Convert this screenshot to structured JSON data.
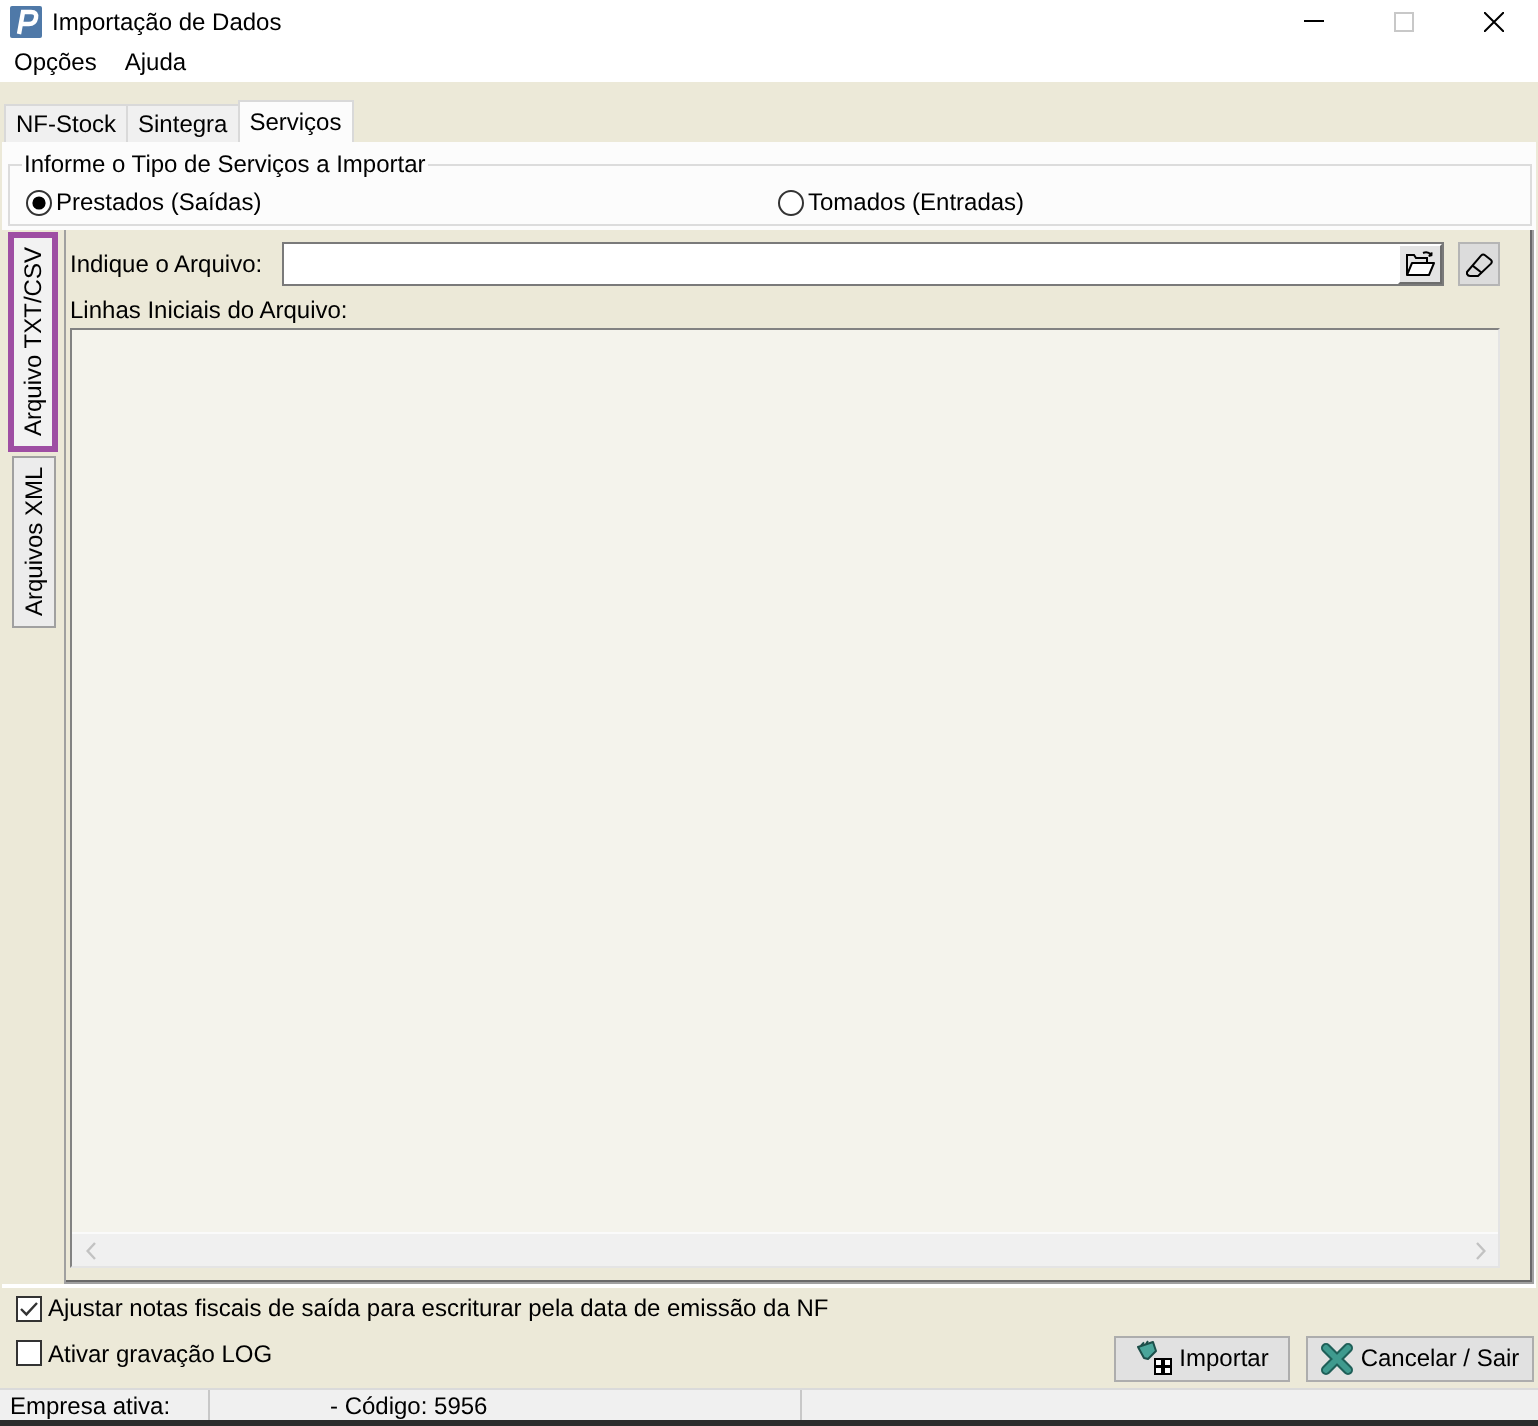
{
  "window": {
    "title": "Importação de Dados"
  },
  "menu": [
    "Opções",
    "Ajuda"
  ],
  "tabs": [
    {
      "label": "NF-Stock",
      "selected": false
    },
    {
      "label": "Sintegra",
      "selected": false
    },
    {
      "label": "Serviços",
      "selected": true
    }
  ],
  "service_type": {
    "legend": "Informe o Tipo de Serviços a Importar",
    "options": [
      {
        "label": "Prestados (Saídas)",
        "selected": true
      },
      {
        "label": "Tomados (Entradas)",
        "selected": false
      }
    ]
  },
  "side_tabs": [
    {
      "label": "Arquivo TXT/CSV",
      "selected": true
    },
    {
      "label": "Arquivos XML",
      "selected": false
    }
  ],
  "file": {
    "label": "Indique o Arquivo:"
  },
  "preview": {
    "label": "Linhas Iniciais do Arquivo:"
  },
  "options": [
    {
      "label": "Ajustar notas fiscais de saída para escriturar pela data de emissão da NF",
      "checked": true
    },
    {
      "label": "Ativar gravação LOG",
      "checked": false
    }
  ],
  "buttons": [
    {
      "label": "Importar",
      "kind": "import"
    },
    {
      "label": "Cancelar / Sair",
      "kind": "cancel"
    }
  ],
  "status_bar": [
    "Empresa ativa:",
    "- Código: 5956"
  ]
}
